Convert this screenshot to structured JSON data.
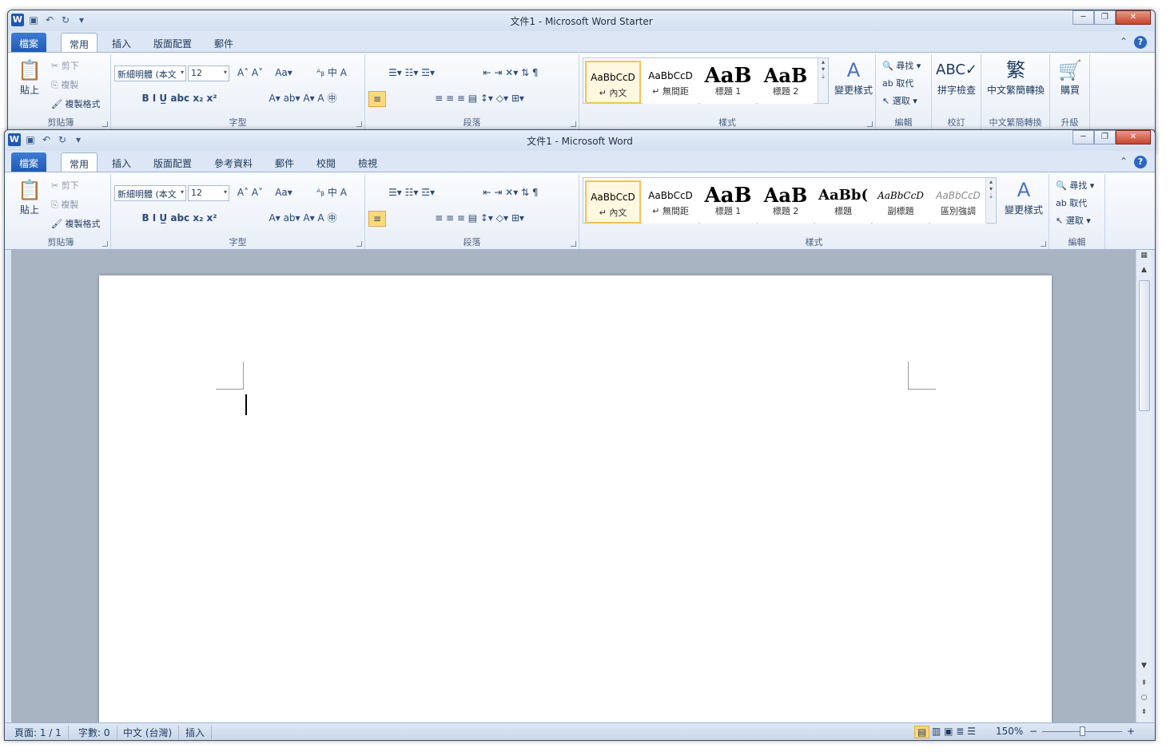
{
  "back_window": {
    "title": "文件1 - Microsoft Word Starter",
    "tabs": [
      "檔案",
      "常用",
      "插入",
      "版面配置",
      "郵件"
    ],
    "clipboard": {
      "paste": "貼上",
      "cut": "剪下",
      "copy": "複製",
      "format_painter": "複製格式",
      "label": "剪貼簿"
    },
    "font": {
      "name": "新細明體 (本文",
      "size": "12",
      "label": "字型"
    },
    "paragraph_label": "段落",
    "styles": [
      {
        "preview": "AaBbCcD",
        "name": "↵ 內文"
      },
      {
        "preview": "AaBbCcD",
        "name": "↵ 無間距"
      },
      {
        "preview": "AaB",
        "name": "標題 1"
      },
      {
        "preview": "AaB",
        "name": "標題 2"
      }
    ],
    "styles_label": "樣式",
    "change_styles": "變更樣式",
    "editing": {
      "find": "尋找",
      "replace": "取代",
      "select": "選取",
      "label": "編輯"
    },
    "proofing": {
      "spell": "拼字檢查",
      "label": "校訂"
    },
    "convert": {
      "btn": "中文繁簡轉換",
      "label": "中文繁簡轉換"
    },
    "upgrade": {
      "btn": "購買",
      "label": "升級"
    }
  },
  "front_window": {
    "title": "文件1 - Microsoft Word",
    "tabs": [
      "檔案",
      "常用",
      "插入",
      "版面配置",
      "參考資料",
      "郵件",
      "校閱",
      "檢視"
    ],
    "clipboard": {
      "paste": "貼上",
      "cut": "剪下",
      "copy": "複製",
      "format_painter": "複製格式",
      "label": "剪貼簿"
    },
    "font": {
      "name": "新細明體 (本文",
      "size": "12",
      "label": "字型"
    },
    "paragraph_label": "段落",
    "styles": [
      {
        "preview": "AaBbCcD",
        "name": "↵ 內文"
      },
      {
        "preview": "AaBbCcD",
        "name": "↵ 無間距"
      },
      {
        "preview": "AaB",
        "name": "標題 1"
      },
      {
        "preview": "AaB",
        "name": "標題 2"
      },
      {
        "preview": "AaBb(",
        "name": "標題"
      },
      {
        "preview": "AaBbCcD",
        "name": "副標題"
      },
      {
        "preview": "AaBbCcD",
        "name": "區別強調"
      }
    ],
    "styles_label": "樣式",
    "change_styles": "變更樣式",
    "editing": {
      "find": "尋找",
      "replace": "取代",
      "select": "選取",
      "label": "編輯"
    },
    "status": {
      "page": "頁面: 1 / 1",
      "words": "字數: 0",
      "lang": "中文 (台灣)",
      "mode": "插入",
      "zoom": "150%"
    },
    "zoom_level": 0.5
  },
  "icons": {
    "minimize": "─",
    "restore": "❐",
    "close": "✕",
    "help": "?",
    "caret": "▾",
    "up": "▲",
    "down": "▼",
    "plus": "+",
    "minus": "−"
  },
  "colors": {
    "file_tab": "#2a66c4",
    "close": "#c7432b",
    "selected_style": "#f3c255"
  }
}
